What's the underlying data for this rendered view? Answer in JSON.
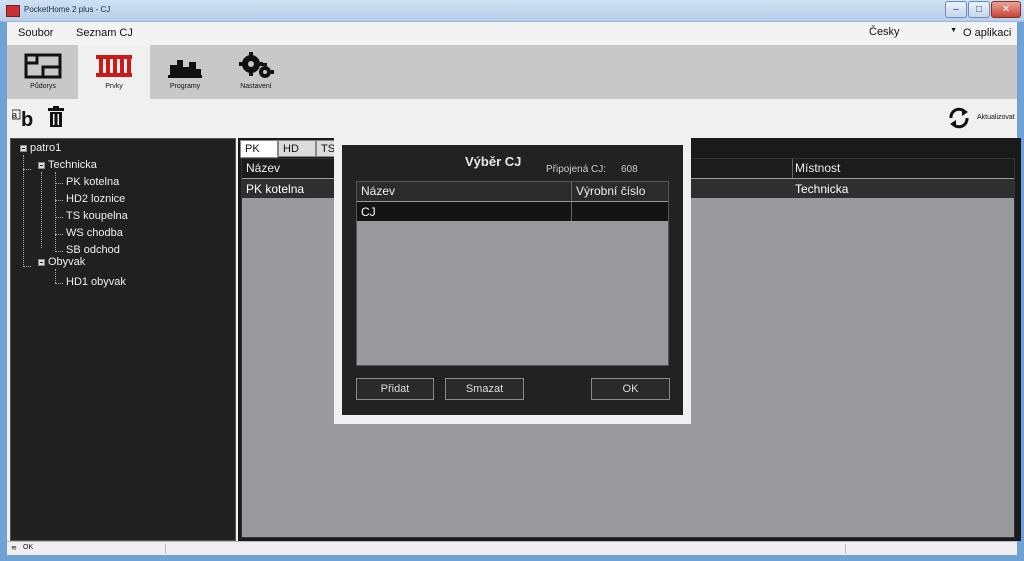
{
  "window": {
    "title": "PocketHome 2 plus - CJ",
    "min": "–",
    "max": "□",
    "close": "✕"
  },
  "menu": {
    "file": "Soubor",
    "cj_list": "Seznam CJ",
    "language": "Česky",
    "about": "O aplikaci"
  },
  "ribbon": {
    "tabs": [
      {
        "label": "Půdorys",
        "icon": "floorplan-icon"
      },
      {
        "label": "Prvky",
        "icon": "radiator-icon"
      },
      {
        "label": "Programy",
        "icon": "programs-icon"
      },
      {
        "label": "Nastavení",
        "icon": "gears-icon"
      }
    ],
    "active_tab": "Prvky"
  },
  "toolbar": {
    "rename_icon": "rename-icon",
    "delete_icon": "trash-icon",
    "refresh_label": "Aktualizovat"
  },
  "tree": {
    "root": "patro1",
    "rooms": [
      {
        "name": "Technicka",
        "items": [
          "PK kotelna",
          "HD2 loznice",
          "TS koupelna",
          "WS chodba",
          "SB odchod"
        ]
      },
      {
        "name": "Obyvak",
        "items": [
          "HD1 obyvak"
        ]
      }
    ]
  },
  "main": {
    "tabs": [
      "PK",
      "HD",
      "TS"
    ],
    "active_tab": "PK",
    "columns": [
      "Název",
      "Místnost"
    ],
    "rows": [
      {
        "name": "PK kotelna",
        "room": "Technicka"
      }
    ]
  },
  "status": {
    "text": "OK"
  },
  "dialog": {
    "title": "Výběr CJ",
    "connected_label": "Připojená CJ:",
    "connected_value": "608",
    "columns": [
      "Název",
      "Výrobní číslo"
    ],
    "rows": [
      {
        "name": "CJ",
        "serial": ""
      }
    ],
    "buttons": {
      "add": "Přidat",
      "delete": "Smazat",
      "ok": "OK"
    }
  }
}
